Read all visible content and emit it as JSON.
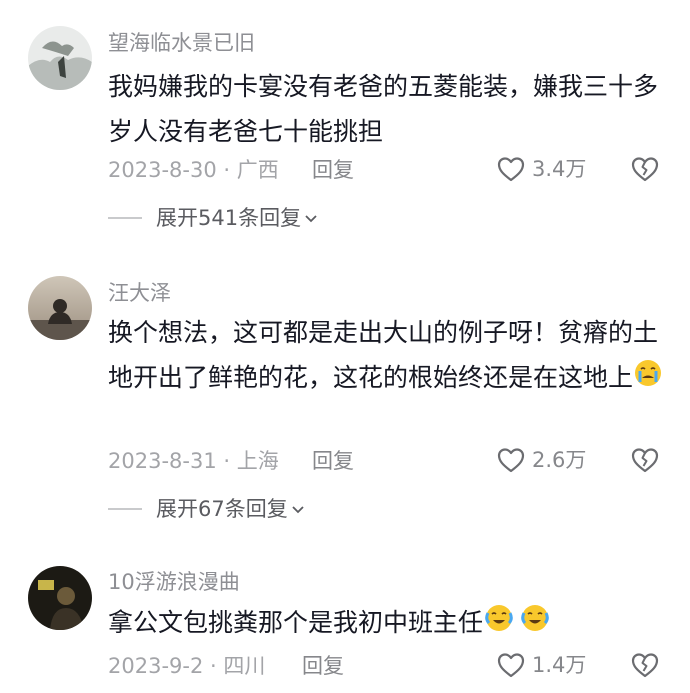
{
  "comments": [
    {
      "username": "望海临水景已旧",
      "text": "我妈嫌我的卡宴没有老爸的五菱能装，嫌我三十多岁人没有老爸七十能挑担",
      "date_location": "2023-8-30 · 广西",
      "reply_label": "回复",
      "likes": "3.4万",
      "expand_label": "展开541条回复"
    },
    {
      "username": "汪大泽",
      "text": "换个想法，这可都是走出大山的例子呀！贫瘠的土地开出了鲜艳的花，这花的根始终还是在这地上",
      "date_location": "2023-8-31 · 上海",
      "reply_label": "回复",
      "likes": "2.6万",
      "expand_label": "展开67条回复"
    },
    {
      "username": "10浮游浪漫曲",
      "text": "拿公文包挑粪那个是我初中班主任",
      "date_location": "2023-9-2 · 四川",
      "reply_label": "回复",
      "likes": "1.4万"
    }
  ],
  "icons": {
    "like": "heart-outline-icon",
    "dislike": "broken-heart-icon",
    "expand": "chevron-down-icon",
    "emoji": "crying-face-emoji"
  },
  "colors": {
    "text": "#161823",
    "secondary": "#86878b",
    "emoji": "#f9c82c"
  }
}
